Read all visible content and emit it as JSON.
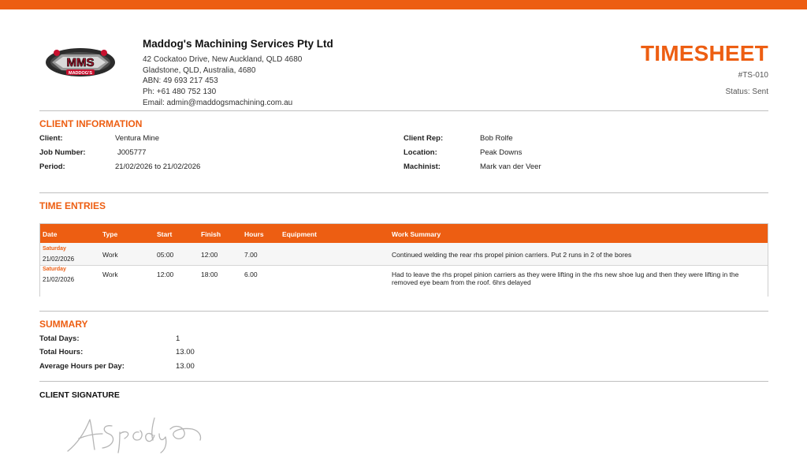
{
  "company": {
    "logo_text": "MMS",
    "logo_subtext": "MADDOG'S",
    "name": "Maddog's Machining Services Pty Ltd",
    "address_line1": "42 Cockatoo Drive, New Auckland, QLD 4680",
    "address_line2": "Gladstone, QLD, Australia, 4680",
    "abn": "ABN: 49 693 217 453",
    "phone": "Ph: +61 480 752 130",
    "email": "Email: admin@maddogsmachining.com.au"
  },
  "document": {
    "title": "TIMESHEET",
    "number": "#TS-010",
    "status_label": "Status:",
    "status_value": "Sent"
  },
  "client_info": {
    "title": "CLIENT INFORMATION",
    "client_label": "Client:",
    "client_value": "Ventura Mine",
    "job_label": "Job Number:",
    "job_value": "J005777",
    "period_label": "Period:",
    "period_value": "21/02/2026 to 21/02/2026",
    "rep_label": "Client Rep:",
    "rep_value": "Bob Rolfe",
    "location_label": "Location:",
    "location_value": "Peak Downs",
    "machinist_label": "Machinist:",
    "machinist_value": "Mark van der Veer"
  },
  "time_entries": {
    "title": "TIME ENTRIES",
    "headers": {
      "date": "Date",
      "type": "Type",
      "start": "Start",
      "finish": "Finish",
      "hours": "Hours",
      "equipment": "Equipment",
      "summary": "Work Summary"
    },
    "rows": [
      {
        "day": "Saturday",
        "date": "21/02/2026",
        "type": "Work",
        "start": "05:00",
        "finish": "12:00",
        "hours": "7.00",
        "equipment": "",
        "summary": "Continued welding the rear rhs propel pinion carriers. Put 2 runs in 2 of the bores"
      },
      {
        "day": "Saturday",
        "date": "21/02/2026",
        "type": "Work",
        "start": "12:00",
        "finish": "18:00",
        "hours": "6.00",
        "equipment": "",
        "summary": "Had to leave the rhs propel pinion carriers as they were lifting in the rhs new shoe lug and then they were lifting in the removed eye beam from the roof. 6hrs delayed"
      }
    ]
  },
  "summary": {
    "title": "SUMMARY",
    "days_label": "Total Days:",
    "days_value": "1",
    "hours_label": "Total Hours:",
    "hours_value": "13.00",
    "avg_label": "Average Hours per Day:",
    "avg_value": "13.00"
  },
  "signature": {
    "title": "CLIENT SIGNATURE"
  },
  "colors": {
    "accent": "#ED5E12",
    "row_alt": "#f6f6f6",
    "rule": "#bfbfbf"
  }
}
